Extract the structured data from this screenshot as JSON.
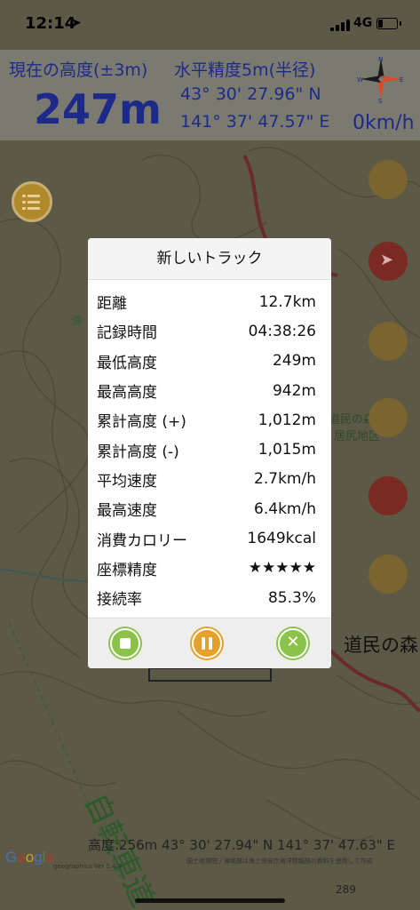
{
  "status_bar": {
    "time": "12:14",
    "network": "4G"
  },
  "header": {
    "altitude_label": "現在の高度(±3m)",
    "altitude_value": "247m",
    "accuracy_label": "水平精度5m(半径)",
    "latitude": "43° 30' 27.96\" N",
    "longitude": "141° 37' 47.57\" E",
    "speed": "0km/h",
    "compass_letters": {
      "n": "N",
      "s": "S",
      "e": "E",
      "w": "W"
    }
  },
  "map": {
    "labels": {
      "a": "道民の森",
      "b": "居尻地区",
      "c": "道民の森",
      "d": "道"
    },
    "bottom_coords": "高度:256m  43° 30' 27.94\" N 141° 37' 47.63\" E",
    "copyright": "国土地理院 / 海域部は海上保安庁海洋情報部の資料を使用して作成",
    "version": "geographica Ver 1.4.4",
    "logo": "Google",
    "scale_label": "289"
  },
  "modal": {
    "title": "新しいトラック",
    "rows": [
      {
        "label": "距離",
        "value": "12.7km"
      },
      {
        "label": "記録時間",
        "value": "04:38:26"
      },
      {
        "label": "最低高度",
        "value": "249m"
      },
      {
        "label": "最高高度",
        "value": "942m"
      },
      {
        "label": "累計高度 (+)",
        "value": "1,012m"
      },
      {
        "label": "累計高度 (-)",
        "value": "1,015m"
      },
      {
        "label": "平均速度",
        "value": "2.7km/h"
      },
      {
        "label": "最高速度",
        "value": "6.4km/h"
      },
      {
        "label": "消費カロリー",
        "value": "1649kcal"
      },
      {
        "label": "座標精度",
        "value": "★★★★★"
      },
      {
        "label": "接続率",
        "value": "85.3%"
      }
    ]
  },
  "colors": {
    "header_text": "#1d2a8a",
    "accent_gold": "#e6a02a",
    "accent_green": "#8bc34a",
    "accent_red": "#c0392b"
  }
}
